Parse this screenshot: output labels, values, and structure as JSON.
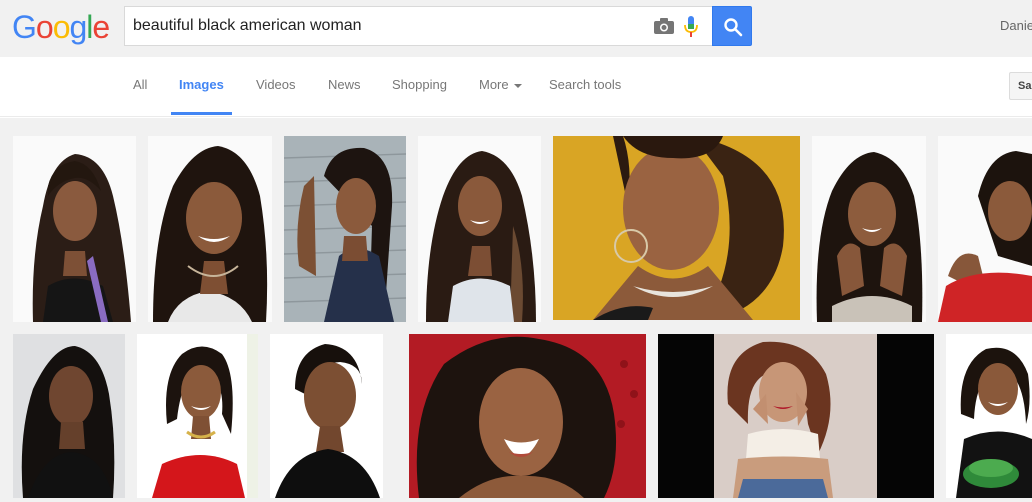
{
  "header": {
    "logo_letters": [
      {
        "char": "G",
        "color": "#4285f4"
      },
      {
        "char": "o",
        "color": "#ea4335"
      },
      {
        "char": "o",
        "color": "#fbbc05"
      },
      {
        "char": "g",
        "color": "#4285f4"
      },
      {
        "char": "l",
        "color": "#34a853"
      },
      {
        "char": "e",
        "color": "#ea4335"
      }
    ],
    "search_query": "beautiful black american woman",
    "user_name": "Danie",
    "accent_color": "#4285f4"
  },
  "tabs": [
    {
      "label": "All",
      "active": false
    },
    {
      "label": "Images",
      "active": true
    },
    {
      "label": "Videos",
      "active": false
    },
    {
      "label": "News",
      "active": false
    },
    {
      "label": "Shopping",
      "active": false
    },
    {
      "label": "More",
      "active": false,
      "has_dropdown": true
    },
    {
      "label": "Search tools",
      "active": false
    }
  ],
  "safe_search_label": "Sa",
  "icons": {
    "camera": "camera-icon",
    "mic": "microphone-icon",
    "search": "search-icon",
    "dropdown": "chevron-down-icon"
  },
  "results": [
    {
      "row": 1,
      "description": "woman with long wavy hair, black top"
    },
    {
      "row": 1,
      "description": "smiling woman with long hair, necklace"
    },
    {
      "row": 1,
      "description": "woman with braided hair against siding"
    },
    {
      "row": 1,
      "description": "smiling woman with long hair, white top"
    },
    {
      "row": 1,
      "description": "woman with curly hair, hoop earrings, yellow background"
    },
    {
      "row": 1,
      "description": "smiling woman resting chin on hands"
    },
    {
      "row": 1,
      "description": "woman in red top, partially cropped"
    },
    {
      "row": 2,
      "description": "woman with short dark hair, black top"
    },
    {
      "row": 2,
      "description": "smiling woman in red dress with necklace"
    },
    {
      "row": 2,
      "description": "young woman with short hair, black top"
    },
    {
      "row": 2,
      "description": "laughing woman with curly hair, red background"
    },
    {
      "row": 2,
      "description": "woman with curly hair posing, dark background"
    },
    {
      "row": 2,
      "description": "smiling woman holding green bowl, partially cropped"
    }
  ]
}
